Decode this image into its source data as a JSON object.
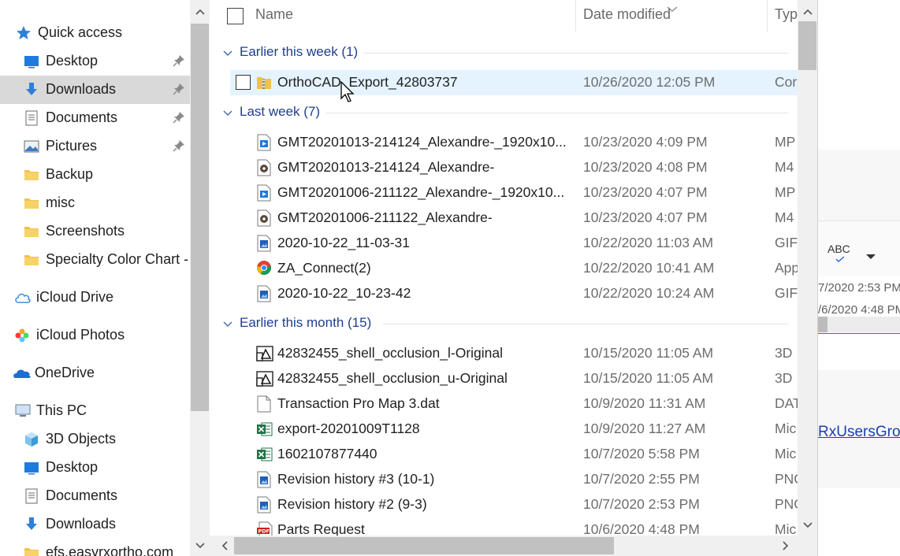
{
  "nav": {
    "items": [
      {
        "label": "Quick access",
        "icon": "star-icon"
      },
      {
        "label": "Desktop",
        "icon": "desktop-icon",
        "pinned": true
      },
      {
        "label": "Downloads",
        "icon": "download-icon",
        "pinned": true,
        "selected": true
      },
      {
        "label": "Documents",
        "icon": "documents-icon",
        "pinned": true
      },
      {
        "label": "Pictures",
        "icon": "pictures-icon",
        "pinned": true
      },
      {
        "label": "Backup",
        "icon": "folder-icon"
      },
      {
        "label": "misc",
        "icon": "folder-icon"
      },
      {
        "label": "Screenshots",
        "icon": "folder-icon"
      },
      {
        "label": "Specialty Color Chart -",
        "icon": "folder-icon"
      },
      {
        "label": "iCloud Drive",
        "icon": "icloud-icon"
      },
      {
        "label": "iCloud Photos",
        "icon": "icloud-photos-icon"
      },
      {
        "label": "OneDrive",
        "icon": "onedrive-icon"
      },
      {
        "label": "This PC",
        "icon": "pc-icon"
      },
      {
        "label": "3D Objects",
        "icon": "3d-objects-icon"
      },
      {
        "label": "Desktop",
        "icon": "desktop-icon"
      },
      {
        "label": "Documents",
        "icon": "documents-icon"
      },
      {
        "label": "Downloads",
        "icon": "download-icon"
      },
      {
        "label": "efs.easyrxortho.com",
        "icon": "folder-icon"
      }
    ]
  },
  "columns": {
    "name": "Name",
    "date": "Date modified",
    "type": "Typ"
  },
  "groups": [
    {
      "label": "Earlier this week (1)"
    },
    {
      "label": "Last week (7)"
    },
    {
      "label": "Earlier this month (15)"
    }
  ],
  "files": [
    {
      "name": "OrthoCAD_Export_42803737",
      "date": "10/26/2020 12:05 PM",
      "type": "Cor",
      "icon": "zip-folder-icon",
      "selected": true
    },
    {
      "name": "GMT20201013-214124_Alexandre-_1920x10...",
      "date": "10/23/2020 4:09 PM",
      "type": "MP",
      "icon": "video-file-icon"
    },
    {
      "name": "GMT20201013-214124_Alexandre-",
      "date": "10/23/2020 4:08 PM",
      "type": "M4",
      "icon": "audio-file-icon"
    },
    {
      "name": "GMT20201006-211122_Alexandre-_1920x10...",
      "date": "10/23/2020 4:07 PM",
      "type": "MP",
      "icon": "video-file-icon"
    },
    {
      "name": "GMT20201006-211122_Alexandre-",
      "date": "10/23/2020 4:07 PM",
      "type": "M4",
      "icon": "audio-file-icon"
    },
    {
      "name": "2020-10-22_11-03-31",
      "date": "10/22/2020 11:03 AM",
      "type": "GIF",
      "icon": "image-file-icon"
    },
    {
      "name": "ZA_Connect(2)",
      "date": "10/22/2020 10:41 AM",
      "type": "App",
      "icon": "chrome-app-icon"
    },
    {
      "name": "2020-10-22_10-23-42",
      "date": "10/22/2020 10:24 AM",
      "type": "GIF",
      "icon": "image-file-icon"
    },
    {
      "name": "42832455_shell_occlusion_l-Original",
      "date": "10/15/2020 11:05 AM",
      "type": "3D",
      "icon": "3d-file-icon"
    },
    {
      "name": "42832455_shell_occlusion_u-Original",
      "date": "10/15/2020 11:05 AM",
      "type": "3D",
      "icon": "3d-file-icon"
    },
    {
      "name": "Transaction Pro Map  3.dat",
      "date": "10/9/2020 11:31 AM",
      "type": "DAT",
      "icon": "blank-file-icon"
    },
    {
      "name": "export-20201009T1128",
      "date": "10/9/2020 11:27 AM",
      "type": "Mic",
      "icon": "excel-file-icon"
    },
    {
      "name": "1602107877440",
      "date": "10/7/2020 5:58 PM",
      "type": "Mic",
      "icon": "excel-file-icon"
    },
    {
      "name": "Revision history #3 (10-1)",
      "date": "10/7/2020 2:55 PM",
      "type": "PNG",
      "icon": "image-file-icon"
    },
    {
      "name": "Revision history #2 (9-3)",
      "date": "10/7/2020 2:53 PM",
      "type": "PNG",
      "icon": "image-file-icon"
    },
    {
      "name": "Parts Request",
      "date": "10/6/2020 4:48 PM",
      "type": "Mic",
      "icon": "pdf-file-icon"
    }
  ],
  "background_window": {
    "spell_label": "ABC",
    "date1": "7/2020 2:53 PM",
    "date2": "/6/2020 4:48 PM",
    "link": "RxUsersGro"
  }
}
